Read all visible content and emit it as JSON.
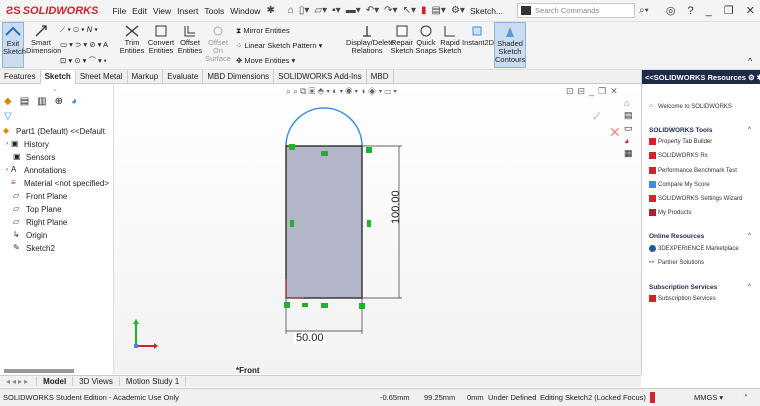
{
  "titlebar": {
    "logo": "SOLIDWORKS",
    "menus": [
      "File",
      "Edit",
      "View",
      "Insert",
      "Tools",
      "Window"
    ],
    "doc_title": "Sketch...",
    "search_placeholder": "Search Commands"
  },
  "ribbon": {
    "exit_sketch": "Exit Sketch",
    "smart_dimension": "Smart Dimension",
    "trim": "Trim Entities",
    "convert": "Convert Entities",
    "offset": "Offset Entities",
    "offset_surface": "Offset On Surface",
    "mirror": "Mirror Entities",
    "linear_pattern": "Linear Sketch Pattern",
    "move": "Move Entities",
    "display_delete": "Display/Delete Relations",
    "repair": "Repair Sketch",
    "quick_snaps": "Quick Snaps",
    "rapid": "Rapid Sketch",
    "instant2d": "Instant2D",
    "shaded": "Shaded Sketch Contours"
  },
  "cm_tabs": [
    "Features",
    "Sketch",
    "Sheet Metal",
    "Markup",
    "Evaluate",
    "MBD Dimensions",
    "SOLIDWORKS Add-Ins",
    "MBD"
  ],
  "active_cm_tab": "Sketch",
  "tree": {
    "part": "Part1 (Default) <<Default",
    "items": [
      "History",
      "Sensors",
      "Annotations",
      "Material <not specified>",
      "Front Plane",
      "Top Plane",
      "Right Plane",
      "Origin",
      "Sketch2"
    ]
  },
  "viewport": {
    "dim_width": "50.00",
    "dim_height": "100.00",
    "view_label": "*Front"
  },
  "taskpane": {
    "title": "<<SOLIDWORKS Resources",
    "welcome": "Welcome to SOLIDWORKS",
    "tools_header": "SOLIDWORKS Tools",
    "tools": [
      "Property Tab Builder",
      "SOLIDWORKS Rx",
      "Performance Benchmark Test",
      "Compare My Score",
      "SOLIDWORKS Settings Wizard",
      "My Products"
    ],
    "online_header": "Online Resources",
    "online": [
      "3DEXPERIENCE Marketplace",
      "Partner Solutions"
    ],
    "subs_header": "Subscription Services",
    "subs": [
      "Subscription Services"
    ]
  },
  "bottom_tabs": [
    "Model",
    "3D Views",
    "Motion Study 1"
  ],
  "active_bottom_tab": "Model",
  "status": {
    "edition": "SOLIDWORKS Student Edition - Academic Use Only",
    "x": "-0.65mm",
    "y": "99.25mm",
    "z": "0mm",
    "state": "Under Defined",
    "editing": "Editing Sketch2 (Locked Focus)",
    "units": "MMGS"
  },
  "colors": {
    "accent": "#d2232a",
    "sketch_fill": "#b3b5c9",
    "relation_green": "#1fb32a",
    "arc_blue": "#3b8fe0"
  }
}
